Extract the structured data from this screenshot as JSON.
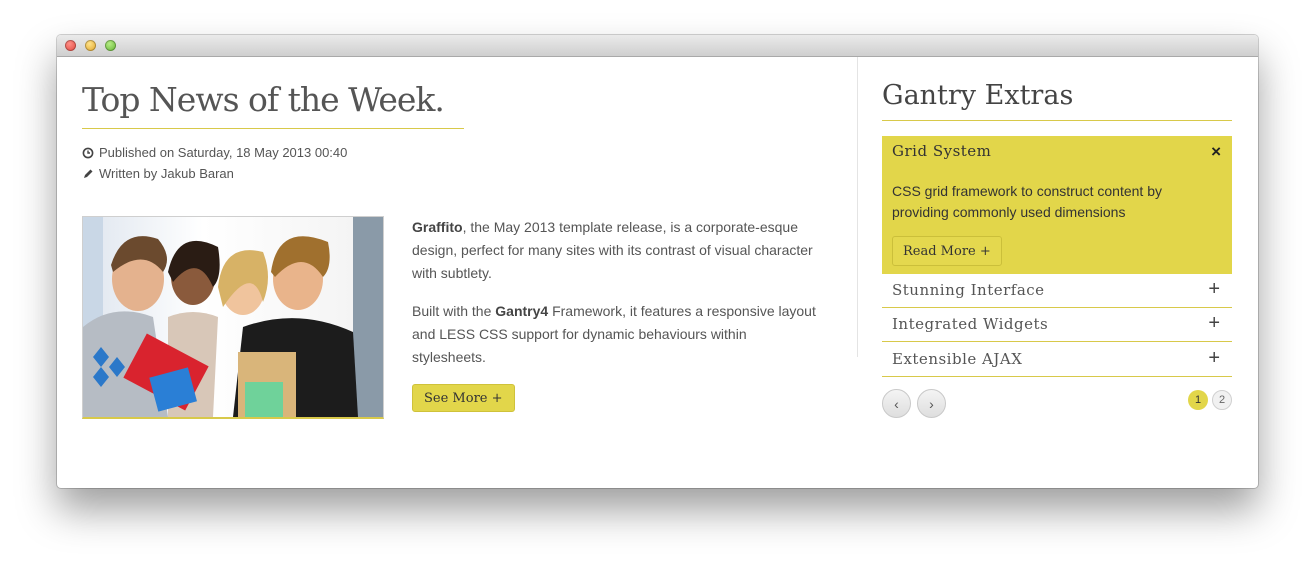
{
  "article": {
    "title": "Top News of the Week.",
    "published": "Published on Saturday, 18 May 2013 00:40",
    "author": "Written by Jakub Baran",
    "p1_bold": "Graffito",
    "p1_rest": ", the May 2013 template release, is a corporate-esque design, perfect for many sites with its contrast of visual character with subtlety.",
    "p2_start": "Built with the ",
    "p2_bold": "Gantry4",
    "p2_rest": " Framework, it features a responsive layout and LESS CSS support for dynamic behaviours within stylesheets.",
    "button": "See More +"
  },
  "sidebar": {
    "title": "Gantry Extras",
    "open": {
      "title": "Grid System",
      "close": "×",
      "body": "CSS grid framework to construct content by providing commonly used dimensions",
      "button": "Read More +"
    },
    "items": [
      {
        "label": "Stunning Interface",
        "icon": "+"
      },
      {
        "label": "Integrated Widgets",
        "icon": "+"
      },
      {
        "label": "Extensible AJAX",
        "icon": "+"
      }
    ],
    "prev": "‹",
    "next": "›",
    "pages": [
      "1",
      "2"
    ]
  },
  "colors": {
    "accent": "#e2d64a",
    "text": "#555555"
  },
  "icons": [
    "clock-icon",
    "pencil-icon",
    "close-icon",
    "plus-icon",
    "chevron-left-icon",
    "chevron-right-icon"
  ]
}
